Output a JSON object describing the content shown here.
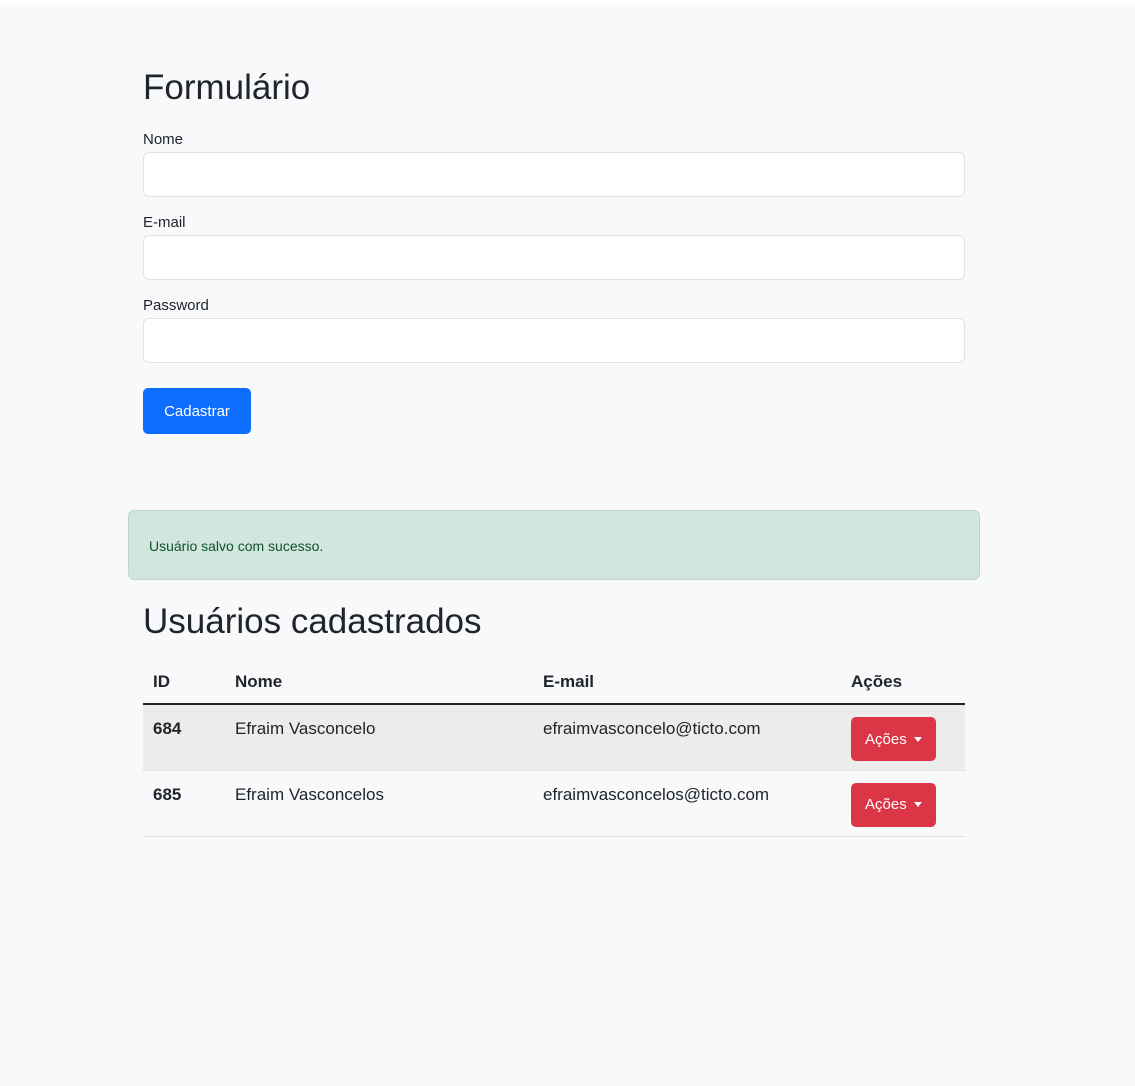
{
  "form": {
    "title": "Formulário",
    "fields": [
      {
        "label": "Nome",
        "value": "",
        "placeholder": ""
      },
      {
        "label": "E-mail",
        "value": "",
        "placeholder": ""
      },
      {
        "label": "Password",
        "value": "",
        "placeholder": ""
      }
    ],
    "submit_label": "Cadastrar"
  },
  "alert": {
    "message": "Usuário salvo com sucesso."
  },
  "users": {
    "title": "Usuários cadastrados",
    "columns": [
      "ID",
      "Nome",
      "E-mail",
      "Ações"
    ],
    "rows": [
      {
        "id": "684",
        "nome": "Efraim Vasconcelo",
        "email": "efraimvasconcelo@ticto.com",
        "action_label": "Ações"
      },
      {
        "id": "685",
        "nome": "Efraim Vasconcelos",
        "email": "efraimvasconcelos@ticto.com",
        "action_label": "Ações"
      }
    ]
  },
  "colors": {
    "background": "#f8f9fa",
    "primary": "#0d6efd",
    "danger": "#dc3545",
    "success_bg": "#d1e7dd",
    "success_text": "#0f5132"
  },
  "icons": {
    "dropdown": "caret-down-icon"
  }
}
